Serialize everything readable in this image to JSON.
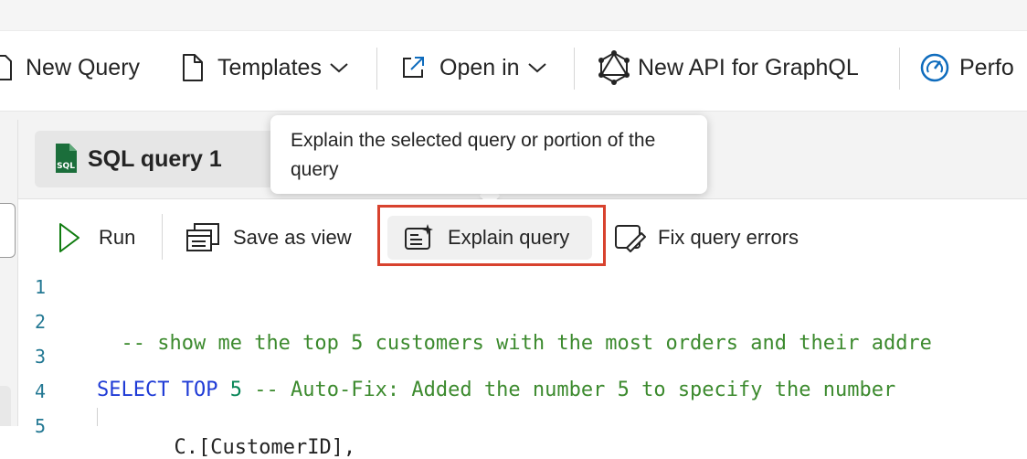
{
  "ribbon": {
    "new_query": "New Query",
    "templates": "Templates",
    "open_in": "Open in",
    "new_api": "New API for GraphQL",
    "perf": "Perfo"
  },
  "tab": {
    "label": "SQL query 1",
    "icon_text": "SQL"
  },
  "tooltip": {
    "text": "Explain the selected query or portion of the query"
  },
  "toolbar": {
    "run": "Run",
    "save_as_view": "Save as view",
    "explain_query": "Explain query",
    "fix_query_errors": "Fix query errors"
  },
  "editor": {
    "line_numbers": [
      "1",
      "2",
      "3",
      "4",
      "5"
    ],
    "line2": "-- show me the top 5 customers with the most orders and their addre",
    "line4_kw1": "SELECT",
    "line4_kw2": "TOP",
    "line4_num": "5",
    "line4_comment": "-- Auto-Fix: Added the number 5 to specify the number",
    "line5": "C.[CustomerID],"
  },
  "colors": {
    "highlight_border": "#d8422e",
    "keyword": "#1f3bd6",
    "comment": "#3c8a2e",
    "line_number": "#237893",
    "accent_blue": "#0f6cbd"
  }
}
